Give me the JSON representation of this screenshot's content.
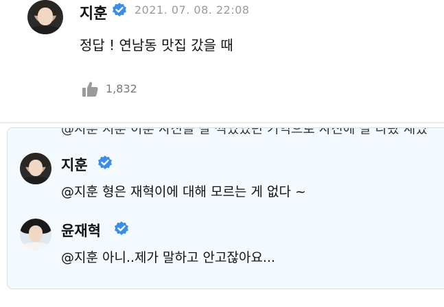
{
  "comment": {
    "author": "지훈",
    "date": "2021. 07. 08. 22:08",
    "text": "정답 ! 연남동 맛집 갔을 때",
    "likes": "1,832"
  },
  "replies": {
    "cut_text": "@지훈 지훈 이훈 사진을 잘 찍었었던 기억으로 사진에 잘 나왔 재밌",
    "items": [
      {
        "author": "지훈",
        "text": "@지훈 형은 재혁이에 대해 모르는 게 없다 ~"
      },
      {
        "author": "윤재혁",
        "text": "@지훈 아니..제가 말하고 안고잖아요..."
      }
    ]
  },
  "colors": {
    "verified": "#3a8ee6",
    "reply_bg": "#f4f9fd",
    "reply_border": "#cfe1ee"
  },
  "icons": [
    "verified-badge-icon",
    "thumbs-up-icon"
  ]
}
